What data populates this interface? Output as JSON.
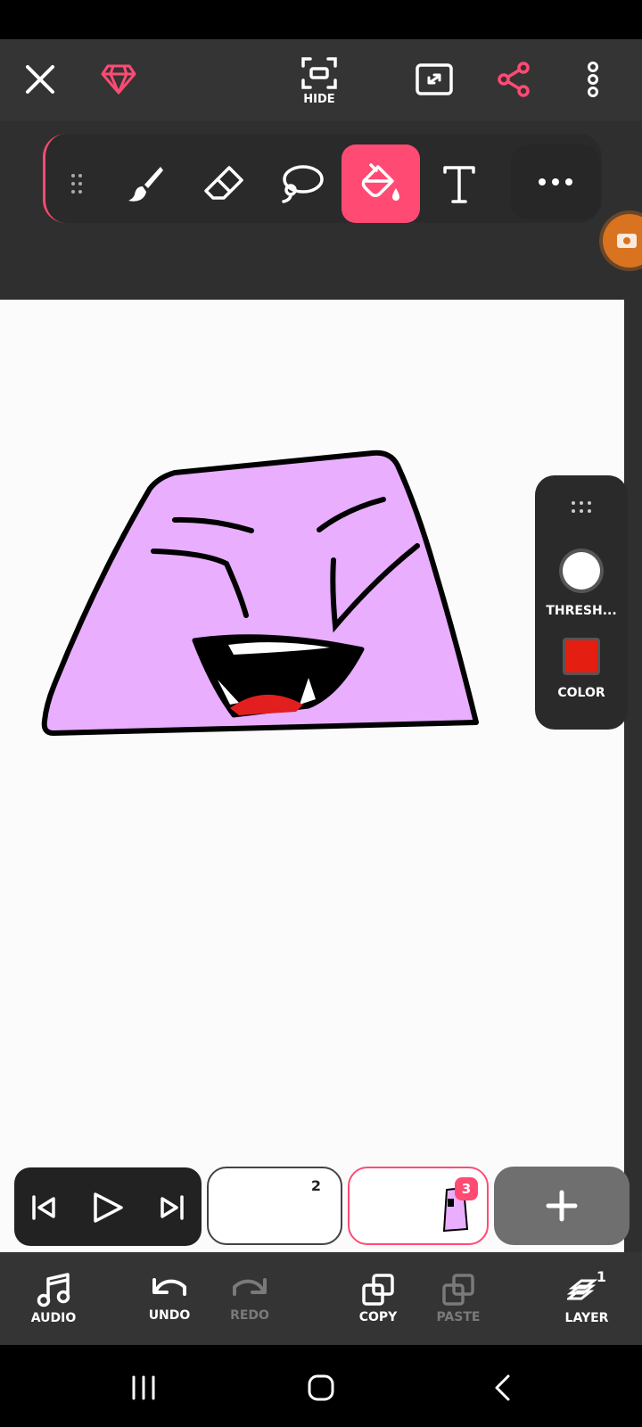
{
  "topbar": {
    "hide_label": "HIDE"
  },
  "side_panel": {
    "threshold_label": "THRESH...",
    "color_label": "COLOR",
    "selected_color": "#e41e10"
  },
  "frames": [
    {
      "number": "2"
    },
    {
      "number": "3"
    }
  ],
  "bottom": {
    "audio": "AUDIO",
    "undo": "UNDO",
    "redo": "REDO",
    "copy": "COPY",
    "paste": "PASTE",
    "layer": "LAYER",
    "layer_count": "1"
  },
  "colors": {
    "accent": "#ff4b73",
    "bg": "#343434",
    "canvas": "#fbfbfb",
    "shape_fill": "#e9aefe"
  }
}
